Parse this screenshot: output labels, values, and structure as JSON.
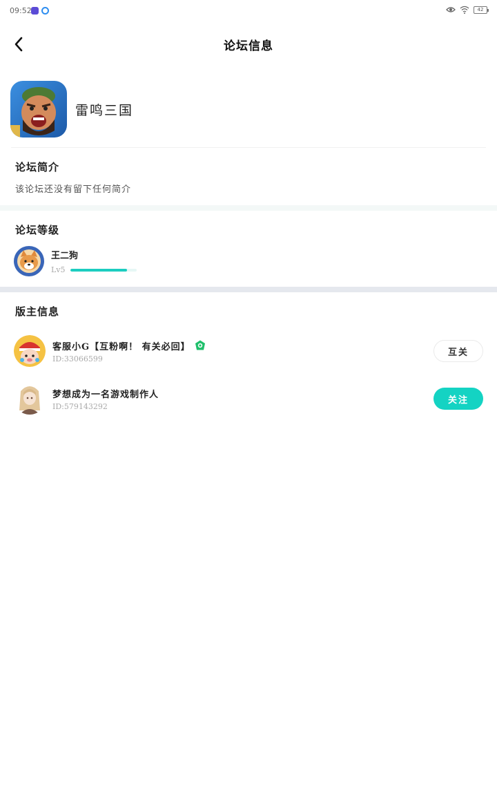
{
  "status_bar": {
    "time": "09:52",
    "battery": "42"
  },
  "nav": {
    "title": "论坛信息"
  },
  "forum": {
    "game_name": "雷鸣三国"
  },
  "intro": {
    "title": "论坛简介",
    "text": "该论坛还没有留下任何简介"
  },
  "level": {
    "title": "论坛等级",
    "user_name": "王二狗",
    "level_text": "Lv5",
    "progress": 0.85
  },
  "moderators": {
    "title": "版主信息",
    "items": [
      {
        "name": "客服小G【互粉啊！ 有关必回】",
        "id": "ID:33066599",
        "button": "互关"
      },
      {
        "name": "梦想成为一名游戏制作人",
        "id": "ID:579143292",
        "button": "关注"
      }
    ]
  },
  "colors": {
    "accent": "#14d3c3",
    "band": "#f3f8f7",
    "band_dark": "#e5e8ee"
  }
}
